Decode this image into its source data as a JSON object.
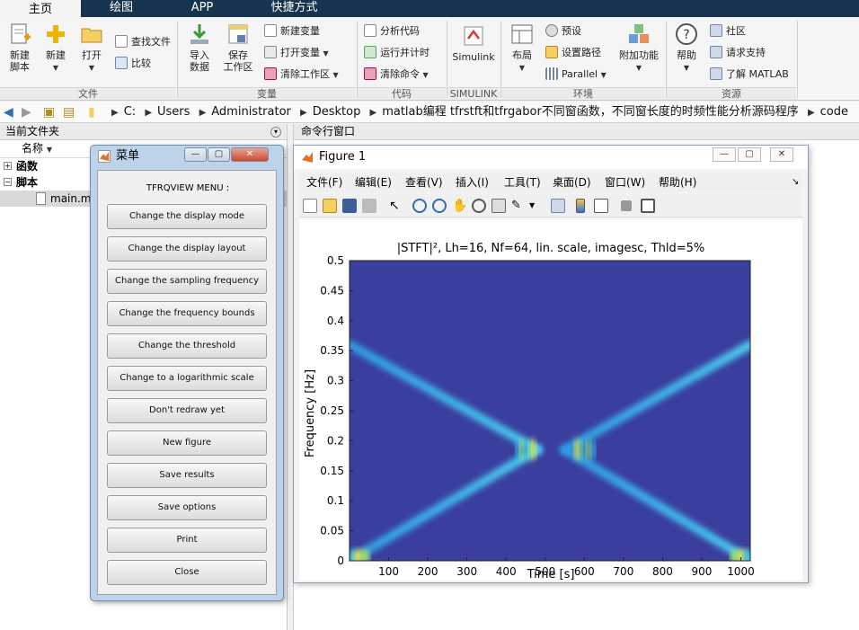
{
  "tabs": [
    {
      "label": "主页",
      "active": true
    },
    {
      "label": "绘图"
    },
    {
      "label": "APP"
    },
    {
      "label": "快捷方式"
    }
  ],
  "ribbon": {
    "file": {
      "new_script": "新建\n脚本",
      "new": "新建",
      "open": "打开",
      "find_files": "查找文件",
      "compare": "比较",
      "group": "文件"
    },
    "variable": {
      "import": "导入\n数据",
      "save_ws": "保存\n工作区",
      "new_var": "新建变量",
      "open_var": "打开变量",
      "clear_ws": "清除工作区",
      "group": "变量"
    },
    "code": {
      "analyze": "分析代码",
      "run_time": "运行并计时",
      "clear_cmd": "清除命令",
      "group": "代码"
    },
    "simulink": {
      "label": "Simulink",
      "group": "SIMULINK"
    },
    "env": {
      "layout": "布局",
      "prefs": "预设",
      "set_path": "设置路径",
      "parallel": "Parallel",
      "addons": "附加功能",
      "group": "环境"
    },
    "resources": {
      "help": "帮助",
      "community": "社区",
      "support": "请求支持",
      "learn": "了解 MATLAB",
      "group": "资源"
    }
  },
  "address": [
    "C:",
    "Users",
    "Administrator",
    "Desktop",
    "matlab编程 tfrstft和tfrgabor不同窗函数，不同窗长度的时频性能分析源码程序",
    "code"
  ],
  "left_panel": {
    "title": "当前文件夹",
    "col_name": "名称",
    "groups": [
      "函数",
      "脚本"
    ],
    "file": "main.m"
  },
  "cmd_panel": {
    "title": "命令行窗口"
  },
  "menu_window": {
    "title": "菜单",
    "heading": "TFRQVIEW MENU :",
    "buttons": [
      "Change the display mode",
      "Change the display layout",
      "Change the sampling frequency",
      "Change the frequency bounds",
      "Change the threshold",
      "Change to a logarithmic scale",
      "Don't redraw yet",
      "New figure",
      "Save results",
      "Save options",
      "Print",
      "Close"
    ]
  },
  "figure": {
    "title": "Figure 1",
    "menu": [
      "文件(F)",
      "编辑(E)",
      "查看(V)",
      "插入(I)",
      "工具(T)",
      "桌面(D)",
      "窗口(W)",
      "帮助(H)"
    ]
  },
  "chart_data": {
    "type": "heatmap",
    "title": "|STFT|², Lh=16, Nf=64, lin. scale, imagesc, Thld=5%",
    "xlabel": "Time [s]",
    "ylabel": "Frequency [Hz]",
    "xlim": [
      0,
      1024
    ],
    "ylim": [
      0,
      0.5
    ],
    "xticks": [
      100,
      200,
      300,
      400,
      500,
      600,
      700,
      800,
      900,
      1000
    ],
    "yticks": [
      0,
      0.05,
      0.1,
      0.15,
      0.2,
      0.25,
      0.3,
      0.35,
      0.4,
      0.45,
      0.5
    ],
    "ridges": [
      {
        "x": [
          0,
          480
        ],
        "y": [
          0.0,
          0.185
        ]
      },
      {
        "x": [
          0,
          480
        ],
        "y": [
          0.36,
          0.185
        ]
      },
      {
        "x": [
          550,
          1024
        ],
        "y": [
          0.185,
          0.0
        ]
      },
      {
        "x": [
          550,
          1024
        ],
        "y": [
          0.185,
          0.36
        ]
      }
    ],
    "background_color": "#3a3f9e"
  },
  "colors": {
    "tabbar": "#16344f",
    "accent": "#2f6fb3"
  }
}
